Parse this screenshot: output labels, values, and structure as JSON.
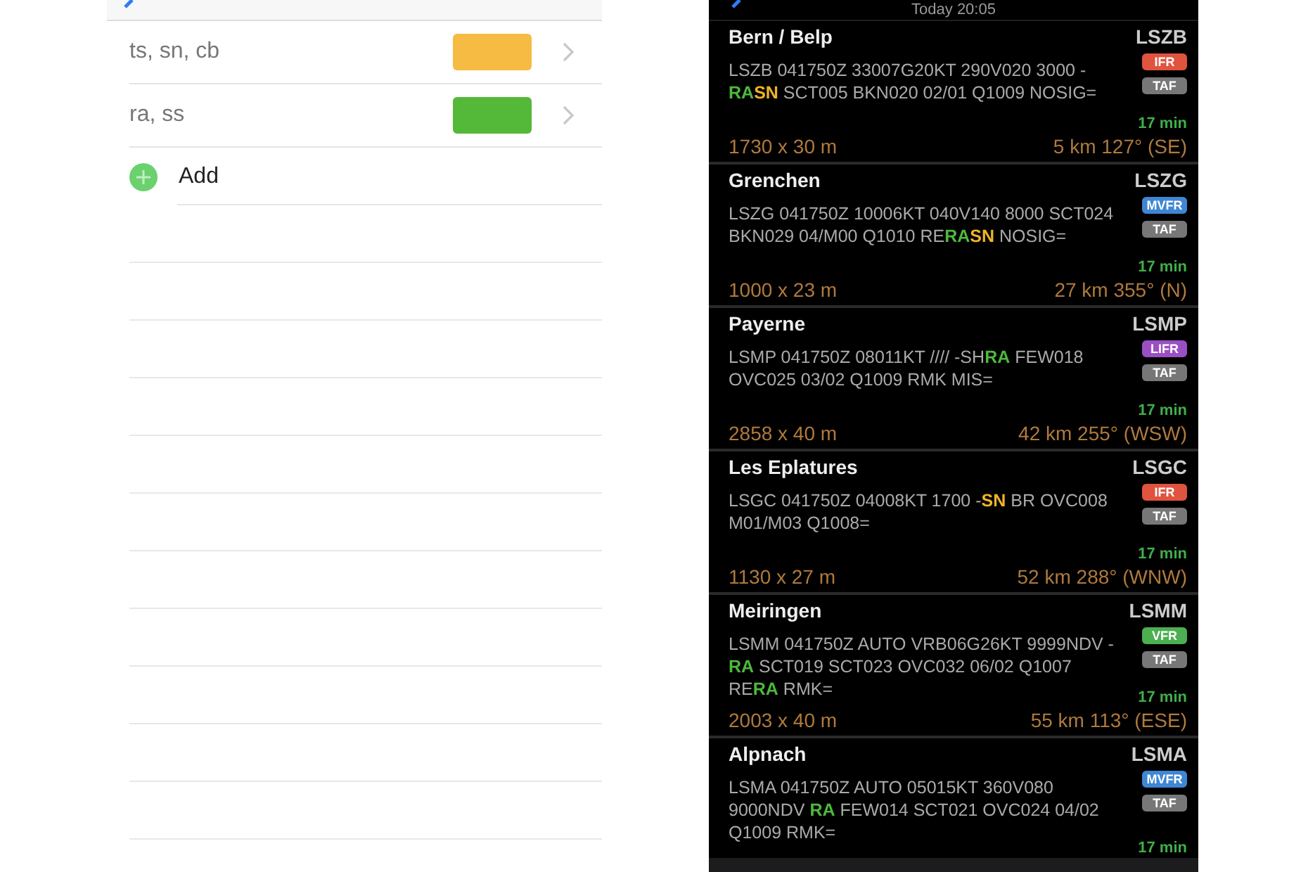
{
  "keywords_screen": {
    "keywords": [
      {
        "label": "ts, sn, cb",
        "color": "#f5bb42"
      },
      {
        "label": "ra, ss",
        "color": "#54b838"
      }
    ],
    "add_label": "Add"
  },
  "weather_screen": {
    "title": "Today 20:05",
    "stations": [
      {
        "name": "Bern / Belp",
        "icao": "LSZB",
        "category": {
          "label": "IFR",
          "color": "#e0533f"
        },
        "taf": "TAF",
        "age": "17 min",
        "metar": [
          {
            "text": "LSZB 041750Z 33007G20KT 290V020 3000 -"
          },
          {
            "text": "RA",
            "color": "#4cb93c"
          },
          {
            "text": "SN",
            "color": "#f0b429"
          },
          {
            "text": " SCT005 BKN020 02/01 Q1009 NOSIG="
          }
        ],
        "runway": "1730 x 30 m",
        "distance": "5 km 127° (SE)"
      },
      {
        "name": "Grenchen",
        "icao": "LSZG",
        "category": {
          "label": "MVFR",
          "color": "#3f86d4"
        },
        "taf": "TAF",
        "age": "17 min",
        "metar": [
          {
            "text": "LSZG 041750Z 10006KT 040V140 8000 SCT024 BKN029 04/M00 Q1010 RE"
          },
          {
            "text": "RA",
            "color": "#4cb93c"
          },
          {
            "text": "SN",
            "color": "#f0b429"
          },
          {
            "text": " NOSIG="
          }
        ],
        "runway": "1000 x 23 m",
        "distance": "27 km 355° (N)"
      },
      {
        "name": "Payerne",
        "icao": "LSMP",
        "category": {
          "label": "LIFR",
          "color": "#9a4fc4"
        },
        "taf": "TAF",
        "age": "17 min",
        "metar": [
          {
            "text": "LSMP 041750Z 08011KT //// -SH"
          },
          {
            "text": "RA",
            "color": "#4cb93c"
          },
          {
            "text": " FEW018 OVC025 03/02 Q1009 RMK MIS="
          }
        ],
        "runway": "2858 x 40 m",
        "distance": "42 km 255° (WSW)"
      },
      {
        "name": "Les Eplatures",
        "icao": "LSGC",
        "category": {
          "label": "IFR",
          "color": "#e0533f"
        },
        "taf": "TAF",
        "age": "17 min",
        "metar": [
          {
            "text": "LSGC 041750Z 04008KT 1700 -"
          },
          {
            "text": "SN",
            "color": "#f0b429"
          },
          {
            "text": " BR OVC008 M01/M03 Q1008="
          }
        ],
        "runway": "1130 x 27 m",
        "distance": "52 km 288° (WNW)"
      },
      {
        "name": "Meiringen",
        "icao": "LSMM",
        "category": {
          "label": "VFR",
          "color": "#4caf50"
        },
        "taf": "TAF",
        "age": "17 min",
        "metar": [
          {
            "text": "LSMM 041750Z AUTO VRB06G26KT 9999NDV -"
          },
          {
            "text": "RA",
            "color": "#4cb93c"
          },
          {
            "text": " SCT019 SCT023 OVC032 06/02 Q1007 RE"
          },
          {
            "text": "RA",
            "color": "#4cb93c"
          },
          {
            "text": " RMK="
          }
        ],
        "runway": "2003 x 40 m",
        "distance": "55 km 113° (ESE)"
      },
      {
        "name": "Alpnach",
        "icao": "LSMA",
        "category": {
          "label": "MVFR",
          "color": "#3f86d4"
        },
        "taf": "TAF",
        "age": "17 min",
        "metar": [
          {
            "text": "LSMA 041750Z AUTO 05015KT 360V080 9000NDV "
          },
          {
            "text": "RA",
            "color": "#4cb93c"
          },
          {
            "text": " FEW014 SCT021 OVC024 04/02 Q1009 RMK="
          }
        ]
      }
    ]
  }
}
